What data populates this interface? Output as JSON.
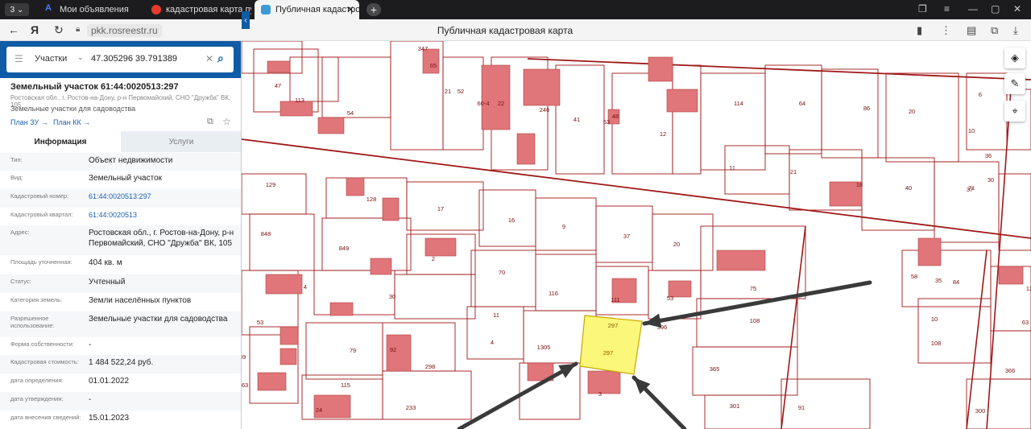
{
  "browser": {
    "tab_count": "3",
    "tabs": [
      {
        "label": "Мои объявления"
      },
      {
        "label": "кадастровая карта публи"
      },
      {
        "label": "Публичная кадастровая"
      }
    ],
    "url": "pkk.rosreestr.ru",
    "page_title": "Публичная кадастровая карта"
  },
  "search": {
    "category": "Участки",
    "value": "47.305296 39.791389"
  },
  "object": {
    "title": "Земельный участок 61:44:0020513:297",
    "address_short": "Ростовская обл., г. Ростов-на-Дону, р-н Первомайский, СНО \"Дружба\" ВК, 105",
    "type": "Земельные участки для садоводства",
    "link_plan_zu": "План ЗУ →",
    "link_plan_kk": "План КК →"
  },
  "tabs": {
    "info": "Информация",
    "services": "Услуги"
  },
  "props": [
    {
      "label": "Тип:",
      "value": "Объект недвижимости"
    },
    {
      "label": "Вид:",
      "value": "Земельный участок"
    },
    {
      "label": "Кадастровый номер:",
      "value": "61:44:0020513:297"
    },
    {
      "label": "Кадастровый квартал:",
      "value": "61:44:0020513"
    },
    {
      "label": "Адрес:",
      "value": "Ростовская обл., г. Ростов-на-Дону, р-н Первомайский, СНО \"Дружба\" ВК, 105"
    },
    {
      "label": "Площадь уточненная:",
      "value": "404 кв. м"
    },
    {
      "label": "Статус:",
      "value": "Учтенный"
    },
    {
      "label": "Категория земель:",
      "value": "Земли населённых пунктов"
    },
    {
      "label": "Разрешенное использование:",
      "value": "Земельные участки для садоводства"
    },
    {
      "label": "Форма собственности:",
      "value": "-"
    },
    {
      "label": "Кадастровая стоимость:",
      "value": "1 484 522,24 руб."
    },
    {
      "label": "дата определения:",
      "value": "01.01.2022"
    },
    {
      "label": "дата утверждения:",
      "value": "-"
    },
    {
      "label": "дата внесения сведений:",
      "value": "15.01.2023"
    }
  ],
  "map": {
    "selected_parcel": "297",
    "labels": [
      "47",
      "347",
      "65",
      "21",
      "52",
      "113",
      "54",
      "60-4",
      "22",
      "246",
      "41",
      "53",
      "48",
      "12",
      "114",
      "64",
      "86",
      "20",
      "6",
      "10",
      "129",
      "128",
      "17",
      "16",
      "9",
      "37",
      "20",
      "11",
      "21",
      "18",
      "40",
      "37",
      "36",
      "30",
      "848",
      "849",
      "2",
      "70",
      "116",
      "111",
      "53",
      "75",
      "58",
      "35",
      "84",
      "10",
      "12",
      "11",
      "4",
      "396",
      "108",
      "108",
      "63",
      "30",
      "4",
      "1305",
      "79",
      "92",
      "298",
      "365",
      "366",
      "53",
      "63",
      "115",
      "233",
      "24",
      "3",
      "301",
      "91",
      "300",
      "71",
      "39",
      "2",
      "110",
      "30",
      "5"
    ],
    "colors": {
      "parcel_line": "#a01818",
      "building": "#e0757a",
      "selected_fill": "#fbf77a"
    }
  }
}
